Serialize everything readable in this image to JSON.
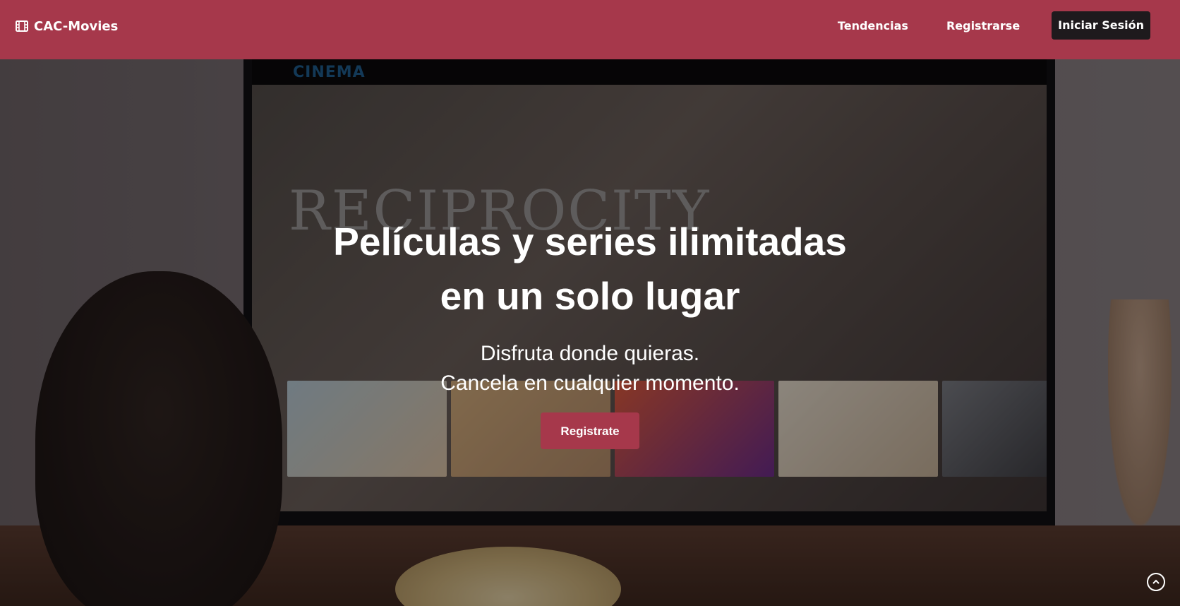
{
  "header": {
    "brand": {
      "icon": "film-icon",
      "label": "CAC-Movies"
    },
    "nav": {
      "trending": "Tendencias",
      "register": "Registrarse",
      "login": "Iniciar Sesión"
    },
    "colors": {
      "bar": "#a6384b",
      "login_button": "#1e1a1d"
    }
  },
  "hero": {
    "background": "person watching a TV streaming interface, popcorn in hand",
    "title_line1": "Películas y series ilimitadas",
    "title_line2": "en un solo lugar",
    "subtitle_line1": "Disfruta donde quieras.",
    "subtitle_line2": "Cancela en cualquier momento.",
    "cta": "Registrate",
    "cta_color": "#a6384b"
  },
  "tv": {
    "logo": "CINEMA",
    "feature_title": "RECIPROCITY"
  },
  "scroll_top": {
    "icon": "chevron-up-circle-icon"
  }
}
